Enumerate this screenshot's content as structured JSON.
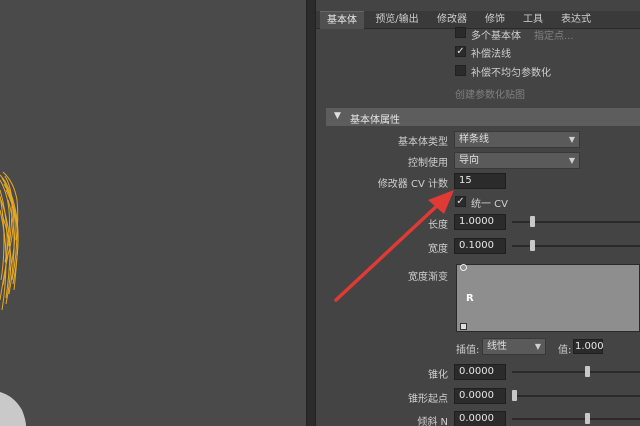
{
  "tabs": [
    "基本体",
    "预览/输出",
    "修改器",
    "修饰",
    "工具",
    "表达式"
  ],
  "top_rows": {
    "multi_primitive_label": "多个基本体",
    "multi_primitive_hint": "指定点...",
    "compensate_normal_label": "补偿法线",
    "compensate_param_label": "补偿不均匀参数化",
    "create_param_map_label": "创建参数化贴图"
  },
  "section": {
    "title": "基本体属性"
  },
  "fields": {
    "primitive_type_label": "基本体类型",
    "primitive_type_value": "样条线",
    "control_usage_label": "控制使用",
    "control_usage_value": "导向",
    "modifier_cv_label": "修改器 CV 计数",
    "modifier_cv_value": "15",
    "uniform_cv_label": "统一 CV",
    "length_label": "长度",
    "length_value": "1.0000",
    "width_label": "宽度",
    "width_value": "0.1000",
    "width_ramp_label": "宽度渐变",
    "ramp_channel": "R",
    "interp_label": "插值:",
    "interp_value": "线性",
    "value_label": "值:",
    "value_value": "1.000",
    "taper_label": "锥化",
    "taper_value": "0.0000",
    "taper_start_label": "锥形起点",
    "taper_start_value": "0.0000",
    "tilt_label": "倾斜 N",
    "tilt_value": "0.0000"
  },
  "colors": {
    "accent_arrow": "#e03a35",
    "hair_strands": "#f0b020"
  },
  "sliders": {
    "length_level": 0.15,
    "width_level": 0.15,
    "taper_level": 0.6,
    "taper_start_level": 0.0,
    "tilt_level": 0.6
  },
  "checks": {
    "multi_primitive": false,
    "compensate_normal": true,
    "compensate_param": false,
    "uniform_cv": true
  }
}
